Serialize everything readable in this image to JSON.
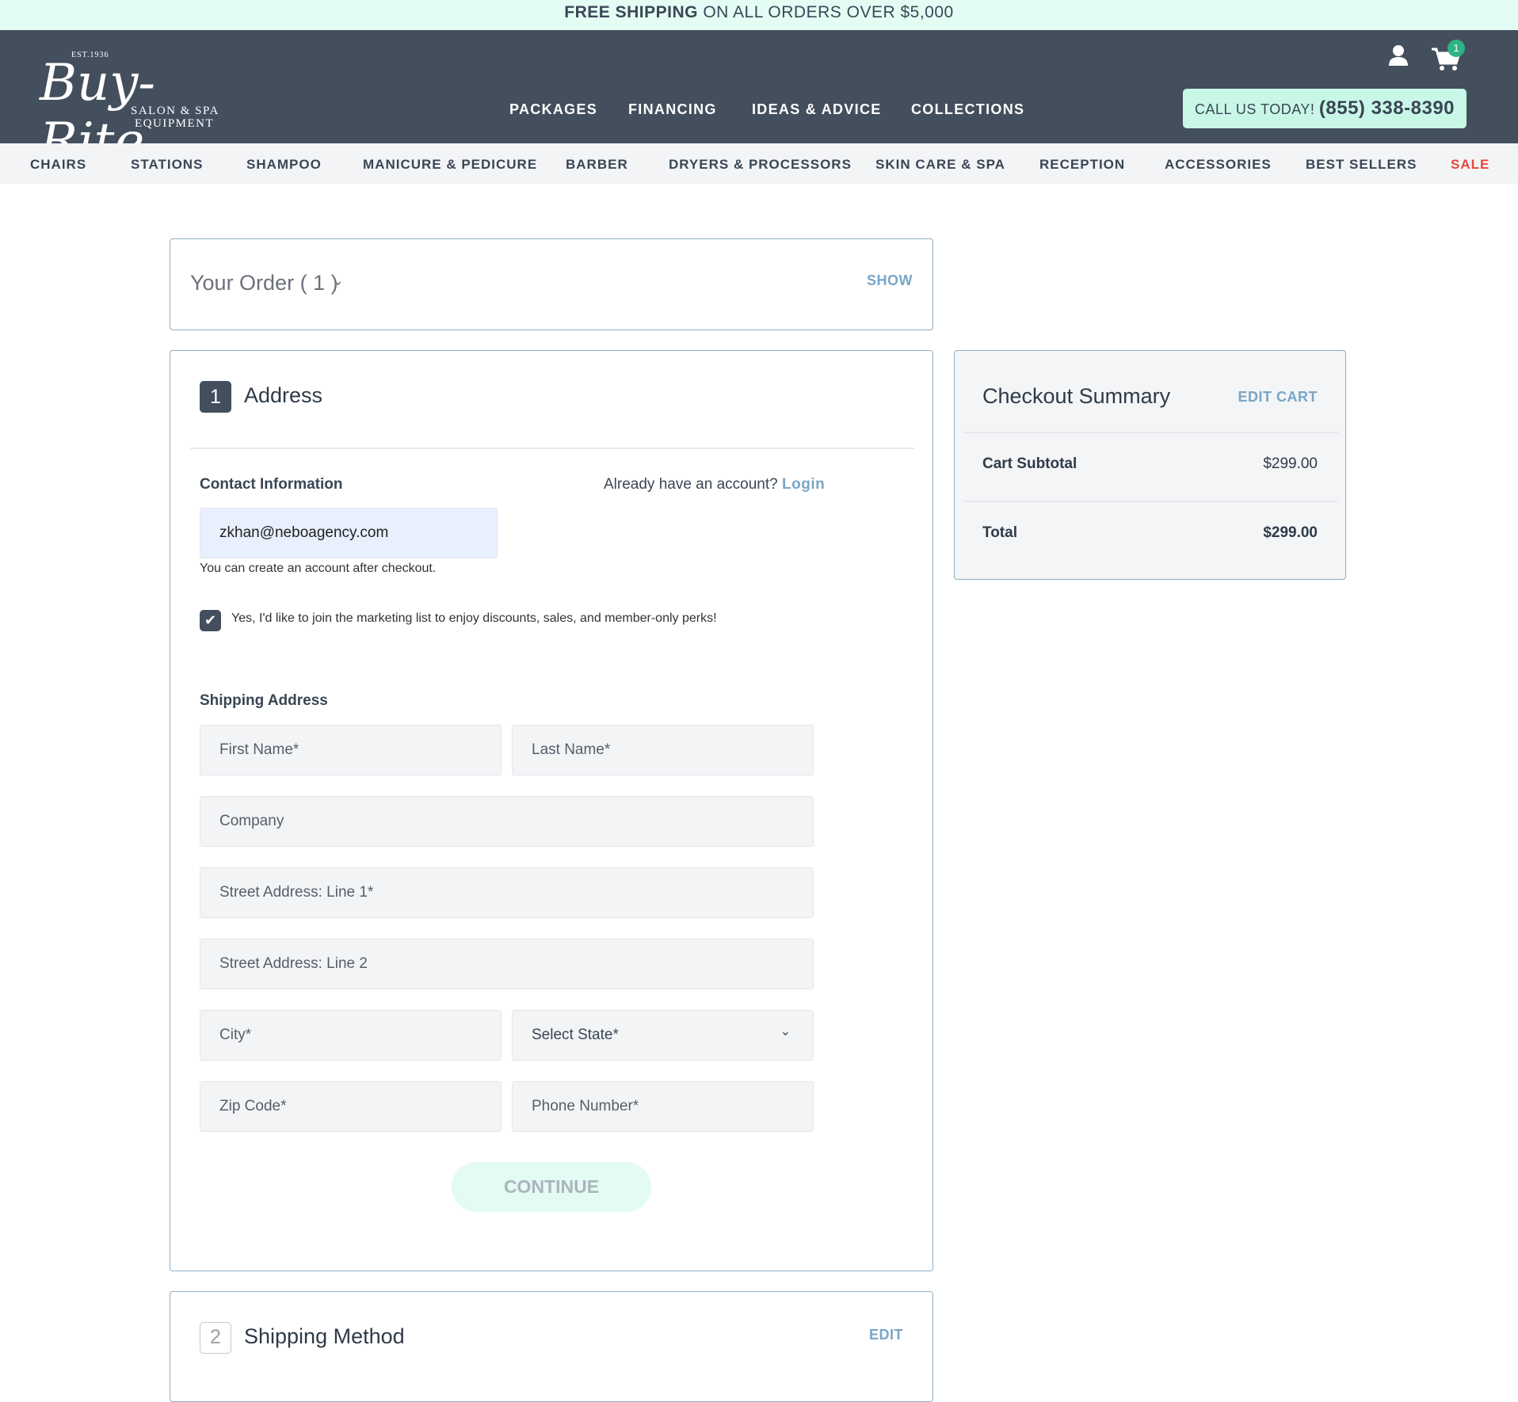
{
  "banner": {
    "bold": "FREE SHIPPING",
    "rest": " ON ALL ORDERS OVER $5,000"
  },
  "header": {
    "logo": {
      "est": "EST.1936",
      "name": "Buy-Rite",
      "tagline1": "SALON & SPA",
      "tagline2": "EQUIPMENT"
    },
    "nav": [
      "PACKAGES",
      "FINANCING",
      "IDEAS & ADVICE",
      "COLLECTIONS"
    ],
    "cart_count": "1",
    "call": {
      "label": "CALL US TODAY!",
      "phone": "(855) 338-8390"
    },
    "icons": [
      "user-icon",
      "cart-icon"
    ]
  },
  "categories": [
    "CHAIRS",
    "STATIONS",
    "SHAMPOO",
    "MANICURE & PEDICURE",
    "BARBER",
    "DRYERS & PROCESSORS",
    "SKIN CARE & SPA",
    "RECEPTION",
    "ACCESSORIES",
    "BEST SELLERS",
    "SALE"
  ],
  "colors": {
    "accent": "#7aa6c6",
    "dark": "#434f5d",
    "mint": "#c9f7e7",
    "sale": "#e8453c"
  },
  "order": {
    "title": "Your Order ( 1 )",
    "show": "SHOW"
  },
  "address": {
    "step": "1",
    "title": "Address",
    "contact_label": "Contact Information",
    "account_prompt": "Already have an account?",
    "login": "Login",
    "email": "zkhan@neboagency.com",
    "email_hint": "You can create an account after checkout.",
    "marketing": "Yes, I'd like to join the marketing list to enjoy discounts, sales, and member-only perks!",
    "marketing_checked": true,
    "shipping_label": "Shipping Address",
    "fields": {
      "first": "First Name*",
      "last": "Last Name*",
      "company": "Company",
      "street1": "Street Address: Line 1*",
      "street2": "Street Address: Line 2",
      "city": "City*",
      "state": "Select State*",
      "zip": "Zip Code*",
      "phone": "Phone Number*"
    },
    "continue": "CONTINUE"
  },
  "summary": {
    "title": "Checkout Summary",
    "edit": "EDIT CART",
    "subtotal_label": "Cart Subtotal",
    "subtotal": "$299.00",
    "total_label": "Total",
    "total": "$299.00"
  },
  "shipping": {
    "step": "2",
    "title": "Shipping Method",
    "edit": "EDIT"
  }
}
